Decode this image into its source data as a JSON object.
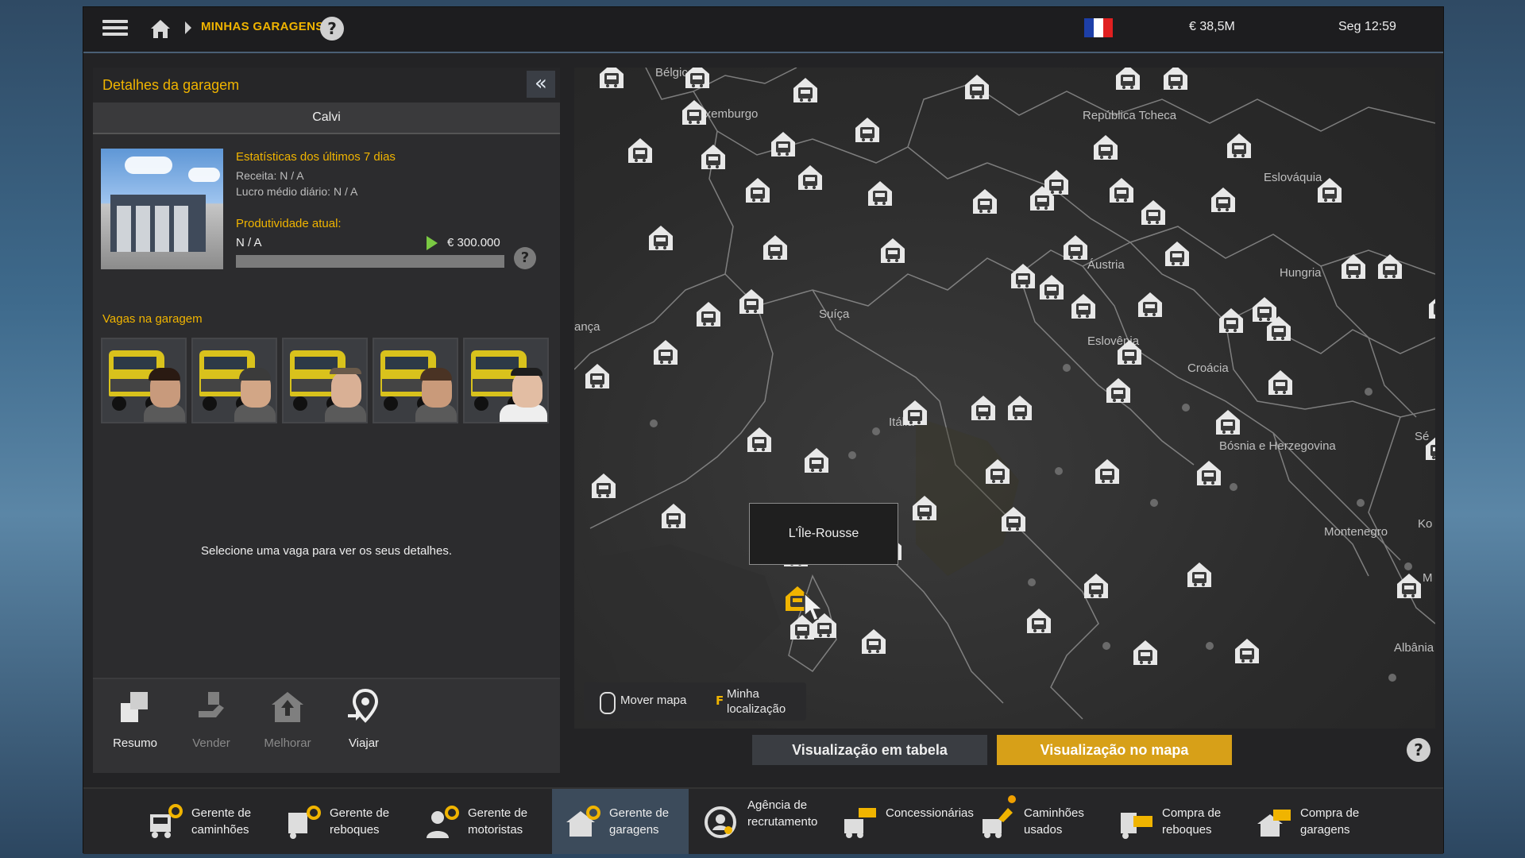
{
  "topbar": {
    "breadcrumb": "MINHAS GARAGENS",
    "help": "?",
    "money": "€ 38,5M",
    "time": "Seg 12:59",
    "flag_colors": [
      "#1d3fa8",
      "#ffffff",
      "#e02020"
    ]
  },
  "details": {
    "title": "Detalhes da garagem",
    "collapse": "«",
    "garage_name": "Calvi",
    "stats_title": "Estatísticas dos últimos 7 dias",
    "revenue": "Receita: N / A",
    "avg_profit": "Lucro médio diário: N / A",
    "productivity_title": "Produtividade atual:",
    "productivity_value": "N / A",
    "productivity_target": "€ 300.000",
    "productivity_fraction": 0.0,
    "help": "?",
    "slots_title": "Vagas na garagem",
    "select_message": "Selecione uma vaga para ver os seus detalhes.",
    "actions": [
      {
        "label": "Resumo",
        "icon": "summary-icon",
        "enabled": true
      },
      {
        "label": "Vender",
        "icon": "sell-icon",
        "enabled": false
      },
      {
        "label": "Melhorar",
        "icon": "upgrade-icon",
        "enabled": false
      },
      {
        "label": "Viajar",
        "icon": "travel-pin-icon",
        "enabled": true
      }
    ]
  },
  "map": {
    "labels": [
      "Bélgica",
      "Luxemburgo",
      "República Tcheca",
      "Eslováquia",
      "Áustria",
      "Hungria",
      "Suíça",
      "Eslovênia",
      "Croácia",
      "Itália",
      "Bósnia e Herzegovina",
      "Montenegro",
      "Albânia",
      "ança",
      "Sé",
      "Ko",
      "M"
    ],
    "tooltip": "L'Île-Rousse",
    "controls": {
      "move_map": "Mover mapa",
      "key": "F",
      "my_location": "Minha localização"
    }
  },
  "view_buttons": {
    "table": "Visualização em tabela",
    "map": "Visualização no mapa",
    "help": "?"
  },
  "bottom_nav": [
    {
      "label": "Gerente de caminhões",
      "icon": "truck-manager-icon"
    },
    {
      "label": "Gerente de reboques",
      "icon": "trailer-manager-icon"
    },
    {
      "label": "Gerente de motoristas",
      "icon": "driver-manager-icon"
    },
    {
      "label": "Gerente de garagens",
      "icon": "garage-manager-icon",
      "active": true
    },
    {
      "label": "Agência de recrutamento",
      "icon": "recruitment-agency-icon"
    },
    {
      "label": "Concessionárias",
      "icon": "dealer-icon"
    },
    {
      "label": "Caminhões usados",
      "icon": "used-trucks-icon",
      "badge": true
    },
    {
      "label": "Compra de reboques",
      "icon": "buy-trailers-icon"
    },
    {
      "label": "Compra de garagens",
      "icon": "buy-garages-icon"
    }
  ],
  "colors": {
    "accent": "#f0b400",
    "map_button": "#d7a018",
    "active_nav": "#3c4b5b"
  }
}
